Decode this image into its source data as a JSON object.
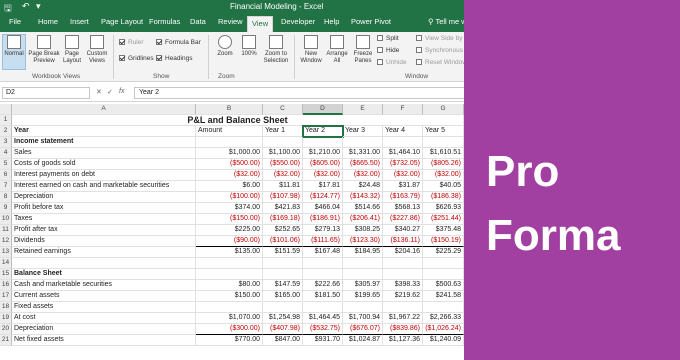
{
  "window": {
    "title": "Financial Modeling  -  Excel"
  },
  "tabs": [
    "File",
    "Home",
    "Insert",
    "Page Layout",
    "Formulas",
    "Data",
    "Review",
    "View",
    "Developer",
    "Help",
    "Power Pivot"
  ],
  "active_tab": "View",
  "tell_me": "Tell me what you",
  "ribbon": {
    "workbook_views": {
      "label": "Workbook Views",
      "buttons": [
        "Normal",
        "Page Break Preview",
        "Page Layout",
        "Custom Views"
      ]
    },
    "show": {
      "label": "Show",
      "ruler": "Ruler",
      "gridlines": "Gridlines",
      "formula_bar": "Formula Bar",
      "headings": "Headings"
    },
    "zoom": {
      "label": "Zoom",
      "buttons": [
        "Zoom",
        "100%",
        "Zoom to Selection"
      ]
    },
    "window": {
      "label": "Window",
      "buttons": [
        "New Window",
        "Arrange All",
        "Freeze Panes"
      ],
      "split": "Split",
      "hide": "Hide",
      "unhide": "Unhide",
      "side_by_side": "View Side by S",
      "sync": "Synchronous",
      "reset": "Reset Window"
    }
  },
  "formula_bar": {
    "name_box": "D2",
    "formula": "Year 2"
  },
  "columns": [
    "A",
    "B",
    "C",
    "D",
    "E",
    "F",
    "G"
  ],
  "sheet_title": "P&L and Balance Sheet",
  "rows": [
    {
      "n": "2",
      "a": "Year",
      "b": "Amount",
      "c": "Year 1",
      "d": "Year 2",
      "e": "Year 3",
      "f": "Year 4",
      "g": "Year 5"
    },
    {
      "n": "3",
      "a": "Income statement",
      "b": "",
      "c": "",
      "d": "",
      "e": "",
      "f": "",
      "g": ""
    },
    {
      "n": "4",
      "a": "Sales",
      "b": "$1,000.00",
      "c": "$1,100.00",
      "d": "$1,210.00",
      "e": "$1,331.00",
      "f": "$1,464.10",
      "g": "$1,610.51"
    },
    {
      "n": "5",
      "a": "Costs of goods sold",
      "b": "($500.00)",
      "c": "($550.00)",
      "d": "($605.00)",
      "e": "($665.50)",
      "f": "($732.05)",
      "g": "($805.26)"
    },
    {
      "n": "6",
      "a": "Interest payments on debt",
      "b": "($32.00)",
      "c": "($32.00)",
      "d": "($32.00)",
      "e": "($32.00)",
      "f": "($32.00)",
      "g": "($32.00)"
    },
    {
      "n": "7",
      "a": "Interest earned on cash and marketable securities",
      "b": "$6.00",
      "c": "$11.81",
      "d": "$17.81",
      "e": "$24.48",
      "f": "$31.87",
      "g": "$40.05"
    },
    {
      "n": "8",
      "a": "Depreciation",
      "b": "($100.00)",
      "c": "($107.98)",
      "d": "($124.77)",
      "e": "($143.32)",
      "f": "($163.79)",
      "g": "($186.38)"
    },
    {
      "n": "9",
      "a": "Profit before tax",
      "b": "$374.00",
      "c": "$421.83",
      "d": "$466.04",
      "e": "$514.66",
      "f": "$568.13",
      "g": "$626.93"
    },
    {
      "n": "10",
      "a": "Taxes",
      "b": "($150.00)",
      "c": "($169.18)",
      "d": "($186.91)",
      "e": "($206.41)",
      "f": "($227.86)",
      "g": "($251.44)"
    },
    {
      "n": "11",
      "a": "Profit after tax",
      "b": "$225.00",
      "c": "$252.65",
      "d": "$279.13",
      "e": "$308.25",
      "f": "$340.27",
      "g": "$375.48"
    },
    {
      "n": "12",
      "a": "Dividends",
      "b": "($90.00)",
      "c": "($101.06)",
      "d": "($111.65)",
      "e": "($123.30)",
      "f": "($136.11)",
      "g": "($150.19)"
    },
    {
      "n": "13",
      "a": "Retained earnings",
      "b": "$135.00",
      "c": "$151.59",
      "d": "$167.48",
      "e": "$184.95",
      "f": "$204.16",
      "g": "$225.29"
    },
    {
      "n": "14",
      "a": "",
      "b": "",
      "c": "",
      "d": "",
      "e": "",
      "f": "",
      "g": ""
    },
    {
      "n": "15",
      "a": "Balance Sheet",
      "b": "",
      "c": "",
      "d": "",
      "e": "",
      "f": "",
      "g": ""
    },
    {
      "n": "16",
      "a": "Cash and marketable securities",
      "b": "$80.00",
      "c": "$147.59",
      "d": "$222.66",
      "e": "$305.97",
      "f": "$398.33",
      "g": "$500.63"
    },
    {
      "n": "17",
      "a": "Current assets",
      "b": "$150.00",
      "c": "$165.00",
      "d": "$181.50",
      "e": "$199.65",
      "f": "$219.62",
      "g": "$241.58"
    },
    {
      "n": "18",
      "a": "Fixed assets",
      "b": "",
      "c": "",
      "d": "",
      "e": "",
      "f": "",
      "g": ""
    },
    {
      "n": "19",
      "a": "At cost",
      "b": "$1,070.00",
      "c": "$1,254.98",
      "d": "$1,464.45",
      "e": "$1,700.94",
      "f": "$1,967.22",
      "g": "$2,266.33"
    },
    {
      "n": "20",
      "a": "Depreciation",
      "b": "($300.00)",
      "c": "($407.98)",
      "d": "($532.75)",
      "e": "($676.07)",
      "f": "($839.86)",
      "g": "($1,026.24)"
    },
    {
      "n": "21",
      "a": "Net fixed assets",
      "b": "$770.00",
      "c": "$847.00",
      "d": "$931.70",
      "e": "$1,024.87",
      "f": "$1,127.36",
      "g": "$1,240.09"
    }
  ],
  "panel": {
    "line1": "Pro",
    "line2": "Forma",
    "color": "#a240a2"
  },
  "colors": {
    "excel_green": "#217346",
    "negative_red": "#c00000"
  }
}
